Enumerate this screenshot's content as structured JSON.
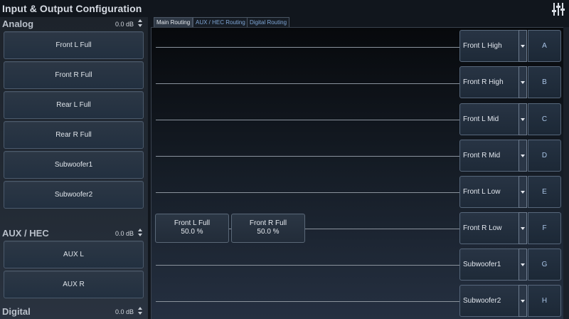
{
  "app": {
    "title": "Input & Output Configuration",
    "settings_icon": "sliders-icon"
  },
  "sections": {
    "analog": {
      "title": "Analog",
      "gain": "0.0 dB",
      "inputs": [
        "Front L Full",
        "Front R Full",
        "Rear L Full",
        "Rear R Full",
        "Subwoofer1",
        "Subwoofer2"
      ]
    },
    "aux": {
      "title": "AUX / HEC",
      "gain": "0.0 dB",
      "inputs": [
        "AUX L",
        "AUX R"
      ]
    },
    "digital": {
      "title": "Digital",
      "gain": "0.0 dB"
    }
  },
  "tabs": [
    {
      "label": "Main Routing",
      "active": true
    },
    {
      "label": "AUX / HEC Routing",
      "active": false
    },
    {
      "label": "Digital Routing",
      "active": false
    }
  ],
  "outputs": [
    {
      "label": "Front L High",
      "channel": "A"
    },
    {
      "label": "Front R High",
      "channel": "B"
    },
    {
      "label": "Front L Mid",
      "channel": "C"
    },
    {
      "label": "Front R Mid",
      "channel": "D"
    },
    {
      "label": "Front L Low",
      "channel": "E"
    },
    {
      "label": "Front R Low",
      "channel": "F"
    },
    {
      "label": "Subwoofer1",
      "channel": "G"
    },
    {
      "label": "Subwoofer2",
      "channel": "H"
    }
  ],
  "routing_sources": [
    {
      "name": "Front L Full",
      "level": "50.0 %"
    },
    {
      "name": "Front R Full",
      "level": "50.0 %"
    }
  ]
}
